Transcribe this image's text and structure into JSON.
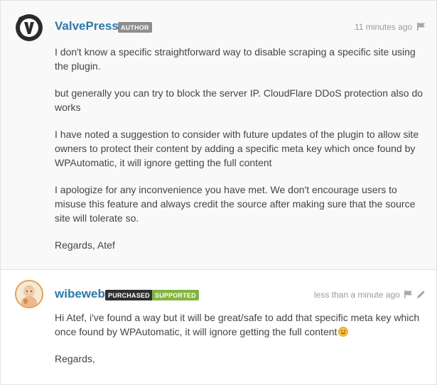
{
  "comments": [
    {
      "username": "ValvePress",
      "badges": [
        "AUTHOR"
      ],
      "time": "11 minutes ago",
      "avatar_icon": "valvepress-logo-icon",
      "paragraphs": [
        "I don't know a specific straightforward way to disable scraping a specific site using the plugin.",
        "but generally you can try to block the server IP. CloudFlare DDoS protection also do works",
        "I have noted a suggestion to consider with future updates of the plugin to allow site owners to protect their content by adding a specific meta key which once found by WPAutomatic, it will ignore getting the full content",
        "I apologize for any inconvenience you have met. We don't encourage users to misuse this feature and always credit the source after making sure that the source site will tolerate so.",
        "Regards, Atef"
      ]
    },
    {
      "username": "wibeweb",
      "badges": [
        "PURCHASED",
        "SUPPORTED"
      ],
      "time": "less than a minute ago",
      "avatar_icon": "baby-photo-avatar",
      "paragraphs": [
        "Hi Atef, i've found a way but it will be great/safe to add that specific meta key which once found by WPAutomatic, it will ignore getting the full content",
        "Regards,"
      ]
    }
  ],
  "colors": {
    "username": "#2b78a8",
    "badge_author": "#8d8d8d",
    "badge_purchased": "#2f2f2f",
    "badge_supported": "#82b541",
    "meta_text": "#9a9a9a"
  },
  "icons": [
    "flag-icon",
    "pencil-icon",
    "smiley-icon"
  ]
}
